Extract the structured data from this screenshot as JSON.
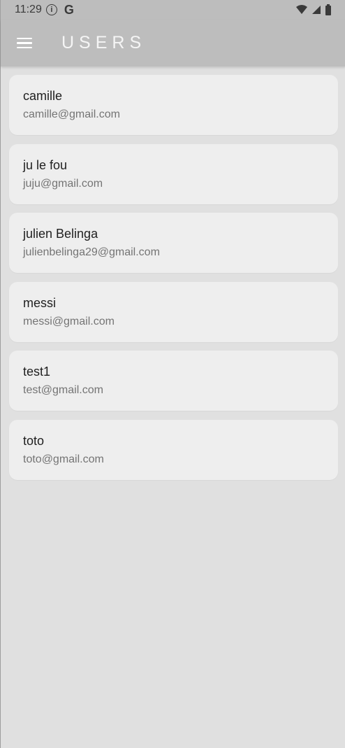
{
  "status_bar": {
    "time": "11:29",
    "info_icon": "info-icon",
    "g_label": "G",
    "icons": [
      "wifi-icon",
      "signal-icon",
      "battery-icon"
    ]
  },
  "app_bar": {
    "title": "USERS",
    "menu_icon": "menu-icon",
    "background": "#bdbdbd"
  },
  "users": [
    {
      "name": "camille",
      "email": "camille@gmail.com"
    },
    {
      "name": "ju le fou",
      "email": "juju@gmail.com"
    },
    {
      "name": "julien Belinga",
      "email": "julienbelinga29@gmail.com"
    },
    {
      "name": "messi",
      "email": "messi@gmail.com"
    },
    {
      "name": "test1",
      "email": "test@gmail.com"
    },
    {
      "name": "toto",
      "email": "toto@gmail.com"
    }
  ],
  "colors": {
    "page_background": "#e0e0e0",
    "card_background": "#eeeeee",
    "name_text": "#1f1f1f",
    "email_text": "#747474"
  }
}
